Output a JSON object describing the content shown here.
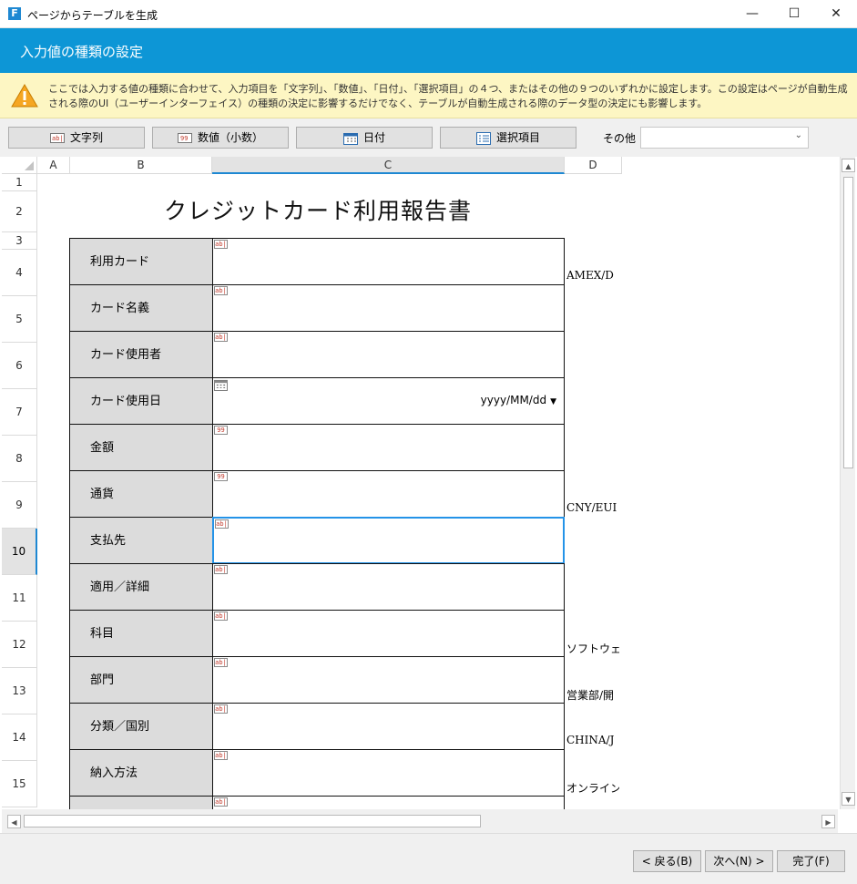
{
  "window": {
    "title": "ページからテーブルを生成",
    "app_icon_letter": "F",
    "minimize_symbol": "—",
    "maximize_symbol": "☐",
    "close_symbol": "✕"
  },
  "header": {
    "title": "入力値の種類の設定"
  },
  "banner": {
    "icon": "warning-icon",
    "text": "ここでは入力する値の種類に合わせて、入力項目を「文字列」、「数値」、「日付」、「選択項目」の４つ、またはその他の９つのいずれかに設定します。この設定はページが自動生成される際のUI（ユーザーインターフェイス）の種類の決定に影響するだけでなく、テーブルが自動生成される際のデータ型の決定にも影響します。"
  },
  "toolbar": {
    "text_button": "文字列",
    "number_button": "数値（小数）",
    "date_button": "日付",
    "select_button": "選択項目",
    "other_label": "その他",
    "other_value": ""
  },
  "columns": [
    "A",
    "B",
    "C",
    "D"
  ],
  "selected_column": "C",
  "rows": [
    "1",
    "2",
    "3",
    "4",
    "5",
    "6",
    "7",
    "8",
    "9",
    "10",
    "11",
    "12",
    "13",
    "14",
    "15"
  ],
  "selected_row": "10",
  "form": {
    "title": "クレジットカード利用報告書",
    "fields": [
      {
        "label": "利用カード",
        "type": "text",
        "d_text": "AMEX/D"
      },
      {
        "label": "カード名義",
        "type": "text",
        "d_text": ""
      },
      {
        "label": "カード使用者",
        "type": "text",
        "d_text": ""
      },
      {
        "label": "カード使用日",
        "type": "date",
        "format": "yyyy/MM/dd",
        "d_text": ""
      },
      {
        "label": "金額",
        "type": "number",
        "d_text": ""
      },
      {
        "label": "通貨",
        "type": "number",
        "d_text": "CNY/EUI"
      },
      {
        "label": "支払先",
        "type": "text",
        "d_text": "",
        "active": true
      },
      {
        "label": "適用／詳細",
        "type": "text",
        "d_text": ""
      },
      {
        "label": "科目",
        "type": "text",
        "d_text": "ソフトウェ"
      },
      {
        "label": "部門",
        "type": "text",
        "d_text": "営業部/開"
      },
      {
        "label": "分類／国別",
        "type": "text",
        "d_text": "CHINA/J"
      },
      {
        "label": "納入方法",
        "type": "text",
        "d_text": "オンライン"
      },
      {
        "label": "",
        "type": "text",
        "d_text": ""
      }
    ]
  },
  "cell_icons": {
    "text": "ab|",
    "number": "99"
  },
  "footer": {
    "back_button": "< 戻る(B)",
    "next_button": "次へ(N) >",
    "finish_button": "完了(F)"
  }
}
